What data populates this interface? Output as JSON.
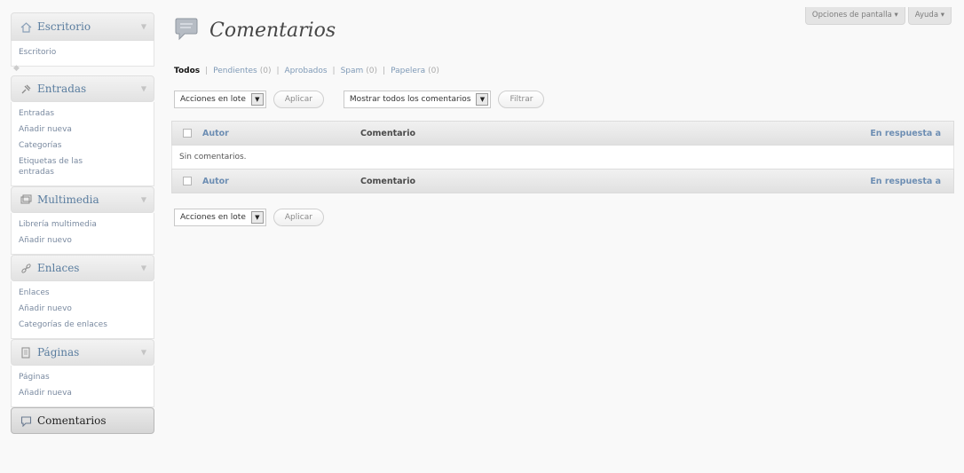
{
  "sidebar": {
    "sections": [
      {
        "label": "Escritorio",
        "icon": "home-icon",
        "items": [
          "Escritorio"
        ]
      },
      {
        "label": "Entradas",
        "icon": "pin-icon",
        "items": [
          "Entradas",
          "Añadir nueva",
          "Categorías",
          "Etiquetas de las",
          "entradas"
        ]
      },
      {
        "label": "Multimedia",
        "icon": "media-icon",
        "items": [
          "Librería multimedia",
          "Añadir nuevo"
        ]
      },
      {
        "label": "Enlaces",
        "icon": "link-icon",
        "items": [
          "Enlaces",
          "Añadir nuevo",
          "Categorías de enlaces"
        ]
      },
      {
        "label": "Páginas",
        "icon": "page-icon",
        "items": [
          "Páginas",
          "Añadir nueva"
        ]
      }
    ],
    "current": {
      "label": "Comentarios",
      "icon": "comment-icon"
    }
  },
  "screen_meta": {
    "screen_options": "Opciones de pantalla ▾",
    "help": "Ayuda ▾"
  },
  "page": {
    "title": "Comentarios"
  },
  "filters": [
    {
      "label": "Todos",
      "count": ""
    },
    {
      "label": "Pendientes",
      "count": "(0)"
    },
    {
      "label": "Aprobados",
      "count": ""
    },
    {
      "label": "Spam",
      "count": "(0)"
    },
    {
      "label": "Papelera",
      "count": "(0)"
    }
  ],
  "tablenav_top": {
    "bulk_actions": "Acciones en lote",
    "apply": "Aplicar",
    "show_filter": "Mostrar todos los comentarios",
    "filter": "Filtrar"
  },
  "table": {
    "columns": {
      "author": "Autor",
      "comment": "Comentario",
      "in_response": "En respuesta a"
    },
    "empty_message": "Sin comentarios."
  },
  "tablenav_bottom": {
    "bulk_actions": "Acciones en lote",
    "apply": "Aplicar"
  }
}
